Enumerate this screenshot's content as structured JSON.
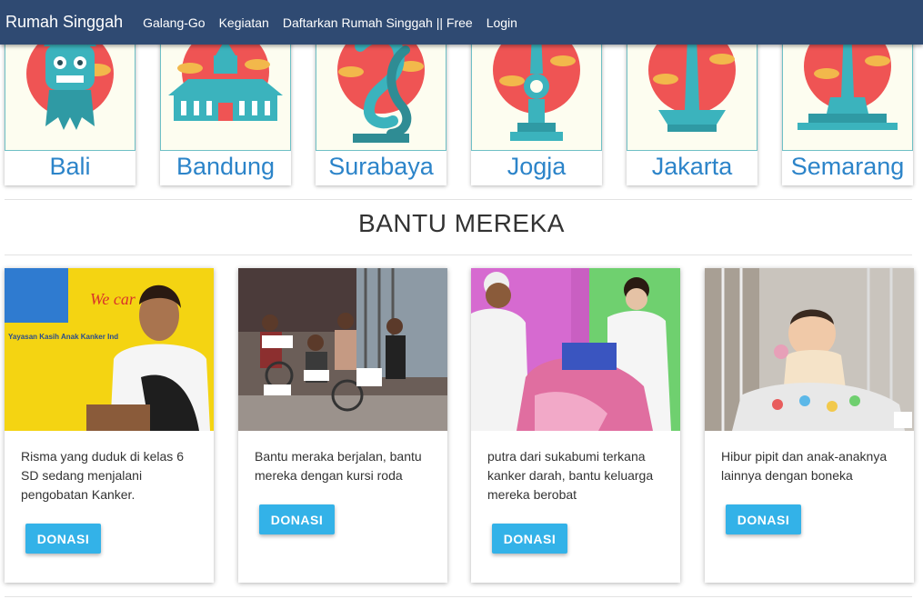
{
  "nav": {
    "brand": "Rumah Singgah",
    "links": [
      "Galang-Go",
      "Kegiatan",
      "Daftarkan Rumah Singgah || Free",
      "Login"
    ]
  },
  "cities": [
    {
      "name": "Bali",
      "icon": "bali-barong-icon"
    },
    {
      "name": "Bandung",
      "icon": "bandung-gedung-sate-icon"
    },
    {
      "name": "Surabaya",
      "icon": "surabaya-suro-boyo-icon"
    },
    {
      "name": "Jogja",
      "icon": "jogja-tugu-icon"
    },
    {
      "name": "Jakarta",
      "icon": "jakarta-monas-icon"
    },
    {
      "name": "Semarang",
      "icon": "semarang-tugu-muda-icon"
    }
  ],
  "section_title": "BANTU MEREKA",
  "donations": [
    {
      "text": "Risma yang duduk di kelas 6 SD sedang menjalani pengobatan Kanker.",
      "button": "DONASI",
      "photo_text_1": "We car",
      "photo_text_2": "Yayasan Kasih Anak Kanker Ind"
    },
    {
      "text": "Bantu meraka berjalan, bantu mereka dengan kursi roda",
      "button": "DONASI"
    },
    {
      "text": "putra dari sukabumi terkana kanker darah, bantu keluarga mereka berobat",
      "button": "DONASI"
    },
    {
      "text": "Hibur pipit dan anak-anaknya lainnya dengan boneka",
      "button": "DONASI"
    }
  ],
  "colors": {
    "navbar": "#2f4a72",
    "city_text": "#2c84c9",
    "button": "#33b2e8",
    "sun": "#ef5454",
    "teal": "#3bb3bd"
  }
}
